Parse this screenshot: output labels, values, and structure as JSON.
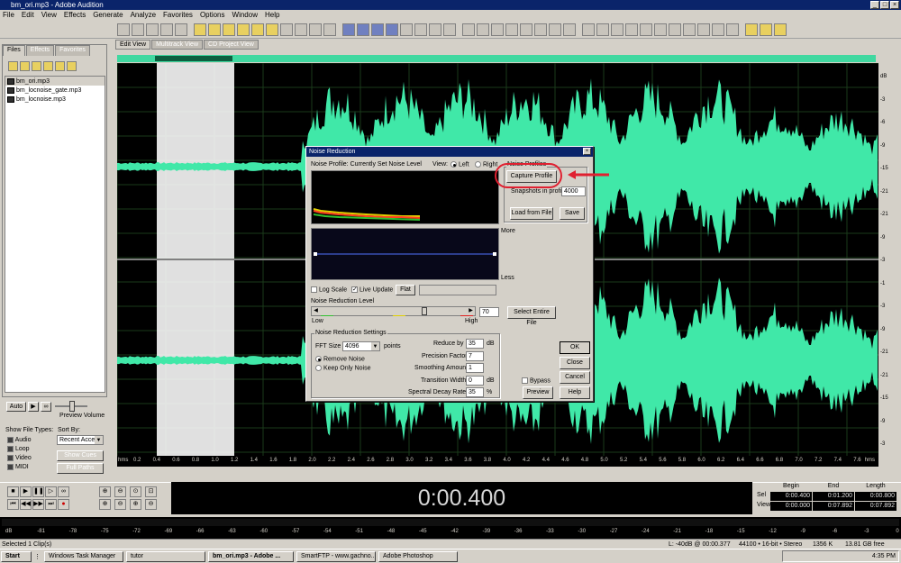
{
  "window": {
    "title": "bm_ori.mp3 - Adobe Audition"
  },
  "menu": [
    "File",
    "Edit",
    "View",
    "Effects",
    "Generate",
    "Analyze",
    "Favorites",
    "Options",
    "Window",
    "Help"
  ],
  "left_panel": {
    "tabs": [
      "Files",
      "Effects",
      "Favorites"
    ],
    "files": [
      "bm_ori.mp3",
      "bm_locnoise_gate.mp3",
      "bm_locnoise.mp3"
    ],
    "auto_label": "Auto",
    "preview_volume": "Preview Volume",
    "show_file_types": "Show File Types:",
    "sort_by": "Sort By:",
    "sort_value": "Recent Acce",
    "types": [
      "Audio",
      "Loop",
      "Video",
      "MIDI"
    ],
    "show_cues": "Show Cues",
    "full_paths": "Full Paths"
  },
  "view_tabs": [
    "Edit View",
    "Multitrack View",
    "CD Project View"
  ],
  "db_scale": [
    "dB",
    "-3",
    "-6",
    "-9",
    "-15",
    "-21",
    "-21",
    "-9",
    "-3",
    "-1",
    "-3",
    "-9",
    "-21",
    "-21",
    "-15",
    "-9",
    "-3"
  ],
  "ruler": {
    "unit": "hms",
    "ticks": [
      "0.2",
      "0.4",
      "0.6",
      "0.8",
      "1.0",
      "1.2",
      "1.4",
      "1.6",
      "1.8",
      "2.0",
      "2.2",
      "2.4",
      "2.6",
      "2.8",
      "3.0",
      "3.2",
      "3.4",
      "3.6",
      "3.8",
      "4.0",
      "4.2",
      "4.4",
      "4.6",
      "4.8",
      "5.0",
      "5.2",
      "5.4",
      "5.6",
      "5.8",
      "6.0",
      "6.2",
      "6.4",
      "6.6",
      "6.8",
      "7.0",
      "7.2",
      "7.4",
      "7.6"
    ],
    "end_unit": "hms"
  },
  "time_display": "0:00.400",
  "selection": {
    "headers": [
      "Begin",
      "End",
      "Length"
    ],
    "sel_label": "Sel",
    "view_label": "View",
    "sel": [
      "0:00.400",
      "0:01.200",
      "0:00.800"
    ],
    "view": [
      "0:00.000",
      "0:07.892",
      "0:07.892"
    ]
  },
  "level_scale": [
    "dB",
    "-81",
    "-78",
    "-75",
    "-72",
    "-69",
    "-66",
    "-63",
    "-60",
    "-57",
    "-54",
    "-51",
    "-48",
    "-45",
    "-42",
    "-39",
    "-36",
    "-33",
    "-30",
    "-27",
    "-24",
    "-21",
    "-18",
    "-15",
    "-12",
    "-9",
    "-6",
    "-3",
    "0"
  ],
  "status": {
    "left": "Selected 1 Clip(s)",
    "level": "L: -40dB @ 00:00.377",
    "format": "44100 • 16-bit • Stereo",
    "size": "1356 K",
    "free": "13.81 GB free"
  },
  "taskbar": {
    "start": "Start",
    "items": [
      "Windows Task Manager",
      "tutor",
      "bm_ori.mp3 - Adobe ...",
      "SmartFTP - www.gachno...",
      "Adobe Photoshop"
    ],
    "clock": "4:35 PM"
  },
  "dialog": {
    "title": "Noise Reduction",
    "profile_label": "Noise Profile: Currently Set Noise Level",
    "view_label": "View:",
    "view_left": "Left",
    "view_right": "Right",
    "profiles_group": "Noise Profiles",
    "capture_profile": "Capture Profile",
    "snapshots_label": "Snapshots in profile",
    "snapshots_value": "4000",
    "load_from_file": "Load from File",
    "save": "Save",
    "more": "More",
    "less": "Less",
    "log_scale": "Log Scale",
    "live_update": "Live Update",
    "flat": "Flat",
    "nr_level_label": "Noise Reduction Level",
    "low": "Low",
    "high": "High",
    "level_value": "70",
    "select_entire_file": "Select Entire File",
    "settings_group": "Noise Reduction Settings",
    "fft_size_label": "FFT Size",
    "fft_size_value": "4096",
    "points": "points",
    "remove_noise": "Remove Noise",
    "keep_only_noise": "Keep Only Noise",
    "reduce_by_label": "Reduce by",
    "reduce_by_value": "35",
    "db": "dB",
    "precision_label": "Precision Factor",
    "precision_value": "7",
    "smoothing_label": "Smoothing Amount",
    "smoothing_value": "1",
    "transition_label": "Transition Width",
    "transition_value": "0",
    "spectral_label": "Spectral Decay Rate",
    "spectral_value": "35",
    "percent": "%",
    "ok": "OK",
    "close": "Close",
    "cancel": "Cancel",
    "help": "Help",
    "bypass": "Bypass",
    "preview": "Preview"
  },
  "colors": {
    "waveform": "#40e8a8",
    "background": "#000000",
    "title_bar": "#0a246a",
    "selection": "#ffffff",
    "annotation": "#e02030"
  }
}
